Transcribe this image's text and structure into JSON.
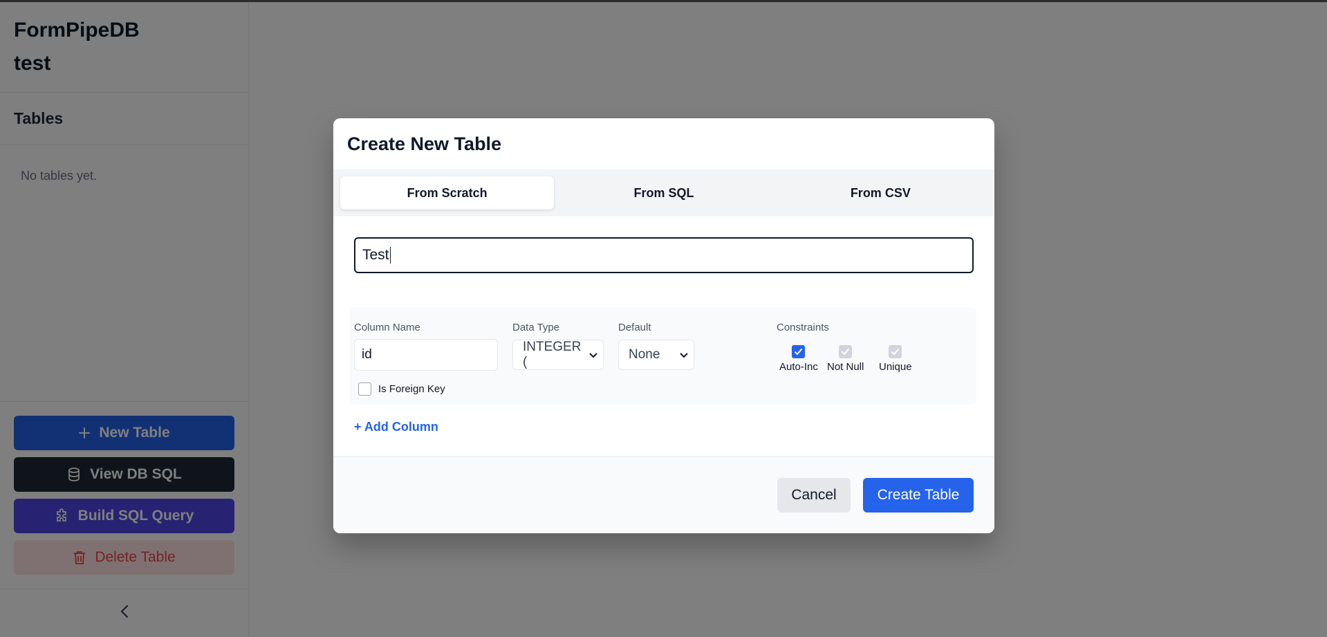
{
  "sidebar": {
    "app_name": "FormPipeDB",
    "db_name": "test",
    "section_title": "Tables",
    "empty_text": "No tables yet.",
    "buttons": {
      "new_table": "New Table",
      "view_db_sql": "View DB SQL",
      "build_sql_query": "Build SQL Query",
      "delete_table": "Delete Table"
    }
  },
  "modal": {
    "title": "Create New Table",
    "tabs": [
      "From Scratch",
      "From SQL",
      "From CSV"
    ],
    "active_tab": "From Scratch",
    "table_name_value": "Test",
    "column": {
      "labels": {
        "name": "Column Name",
        "type": "Data Type",
        "default": "Default",
        "constraints": "Constraints"
      },
      "name_value": "id",
      "type_value": "INTEGER (",
      "default_value": "None",
      "constraints": {
        "auto_inc": "Auto-Inc",
        "not_null": "Not Null",
        "unique": "Unique"
      },
      "foreign_key_label": "Is Foreign Key"
    },
    "add_column": "+ Add Column",
    "cancel": "Cancel",
    "create": "Create Table"
  },
  "colors": {
    "primary": "#2563eb",
    "dark": "#1f2937",
    "indigo": "#4f46e5",
    "danger_bg": "#fee2e2",
    "danger_text": "#ef4444"
  }
}
